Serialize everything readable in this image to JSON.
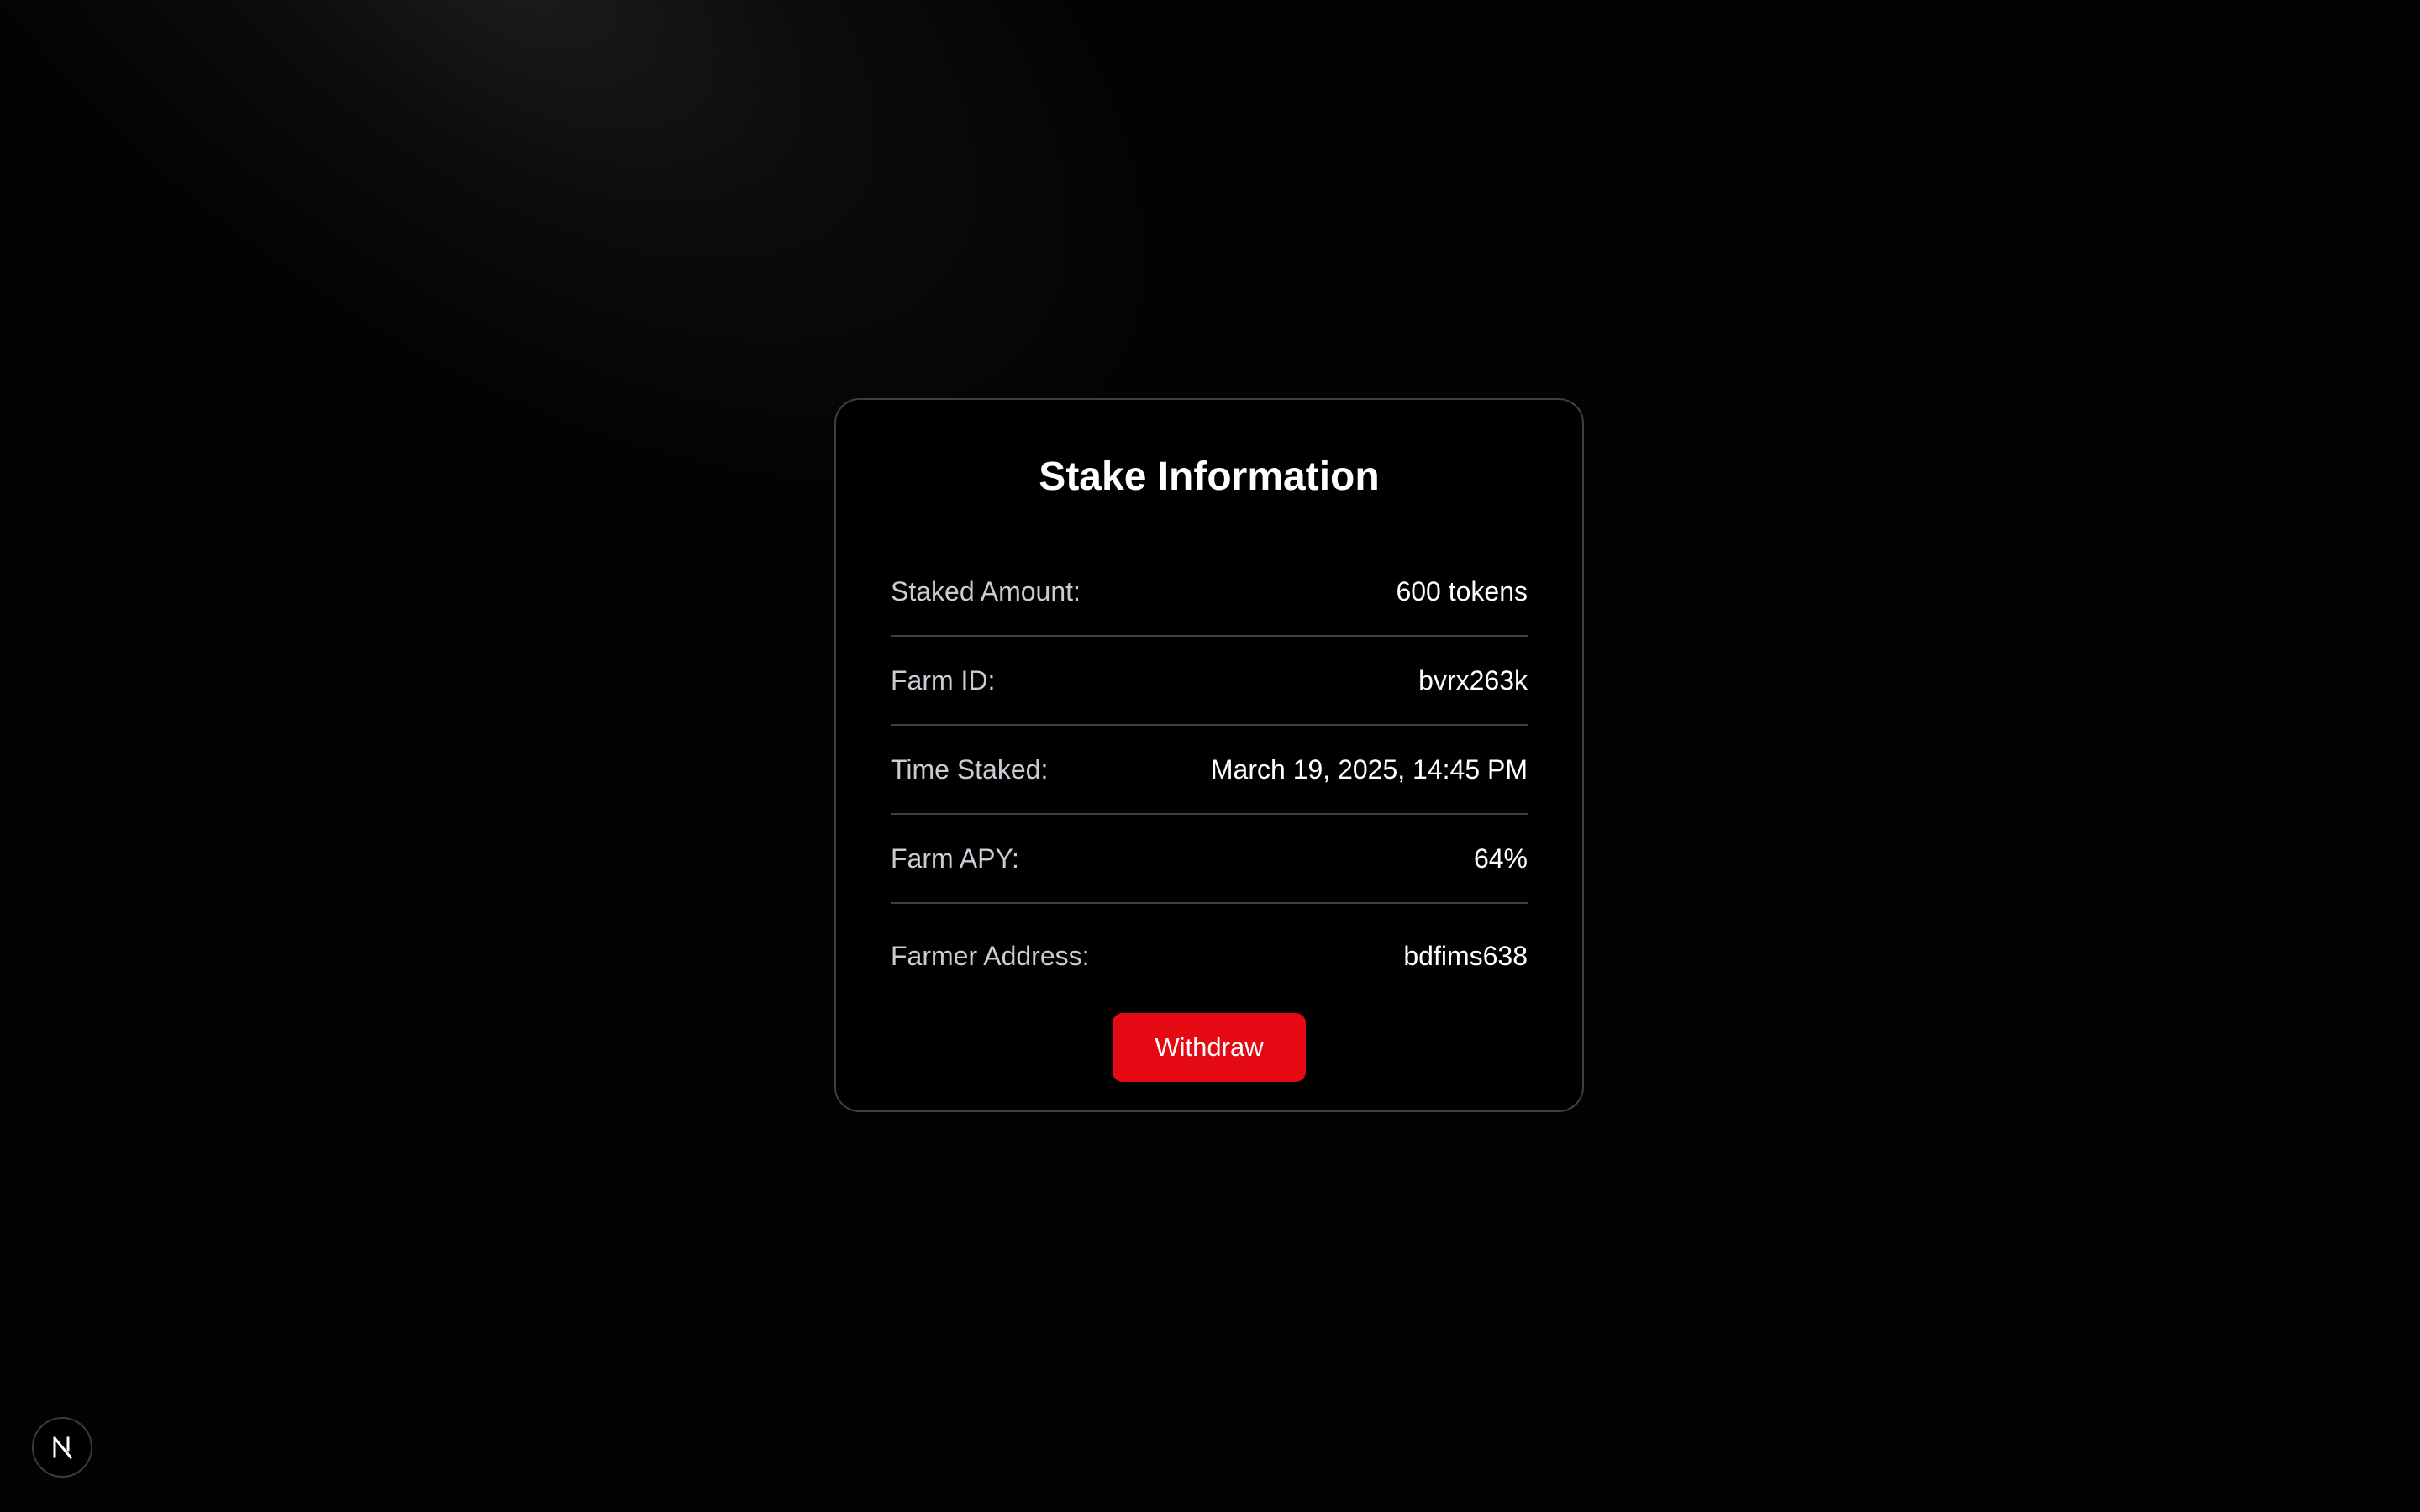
{
  "card": {
    "title": "Stake Information",
    "rows": [
      {
        "label": "Staked Amount:",
        "value": "600 tokens"
      },
      {
        "label": "Farm ID:",
        "value": "bvrx263k"
      },
      {
        "label": "Time Staked:",
        "value": "March 19, 2025, 14:45 PM"
      },
      {
        "label": "Farm APY:",
        "value": "64%"
      },
      {
        "label": "Farmer Address:",
        "value": "bdfims638"
      }
    ],
    "withdraw_label": "Withdraw"
  },
  "colors": {
    "background": "#030303",
    "card_border": "#3b3f4a",
    "accent": "#e50914",
    "label_text": "#c9ccd2",
    "value_text": "#ffffff"
  },
  "icons": {
    "corner_badge": "next-logo-icon"
  }
}
